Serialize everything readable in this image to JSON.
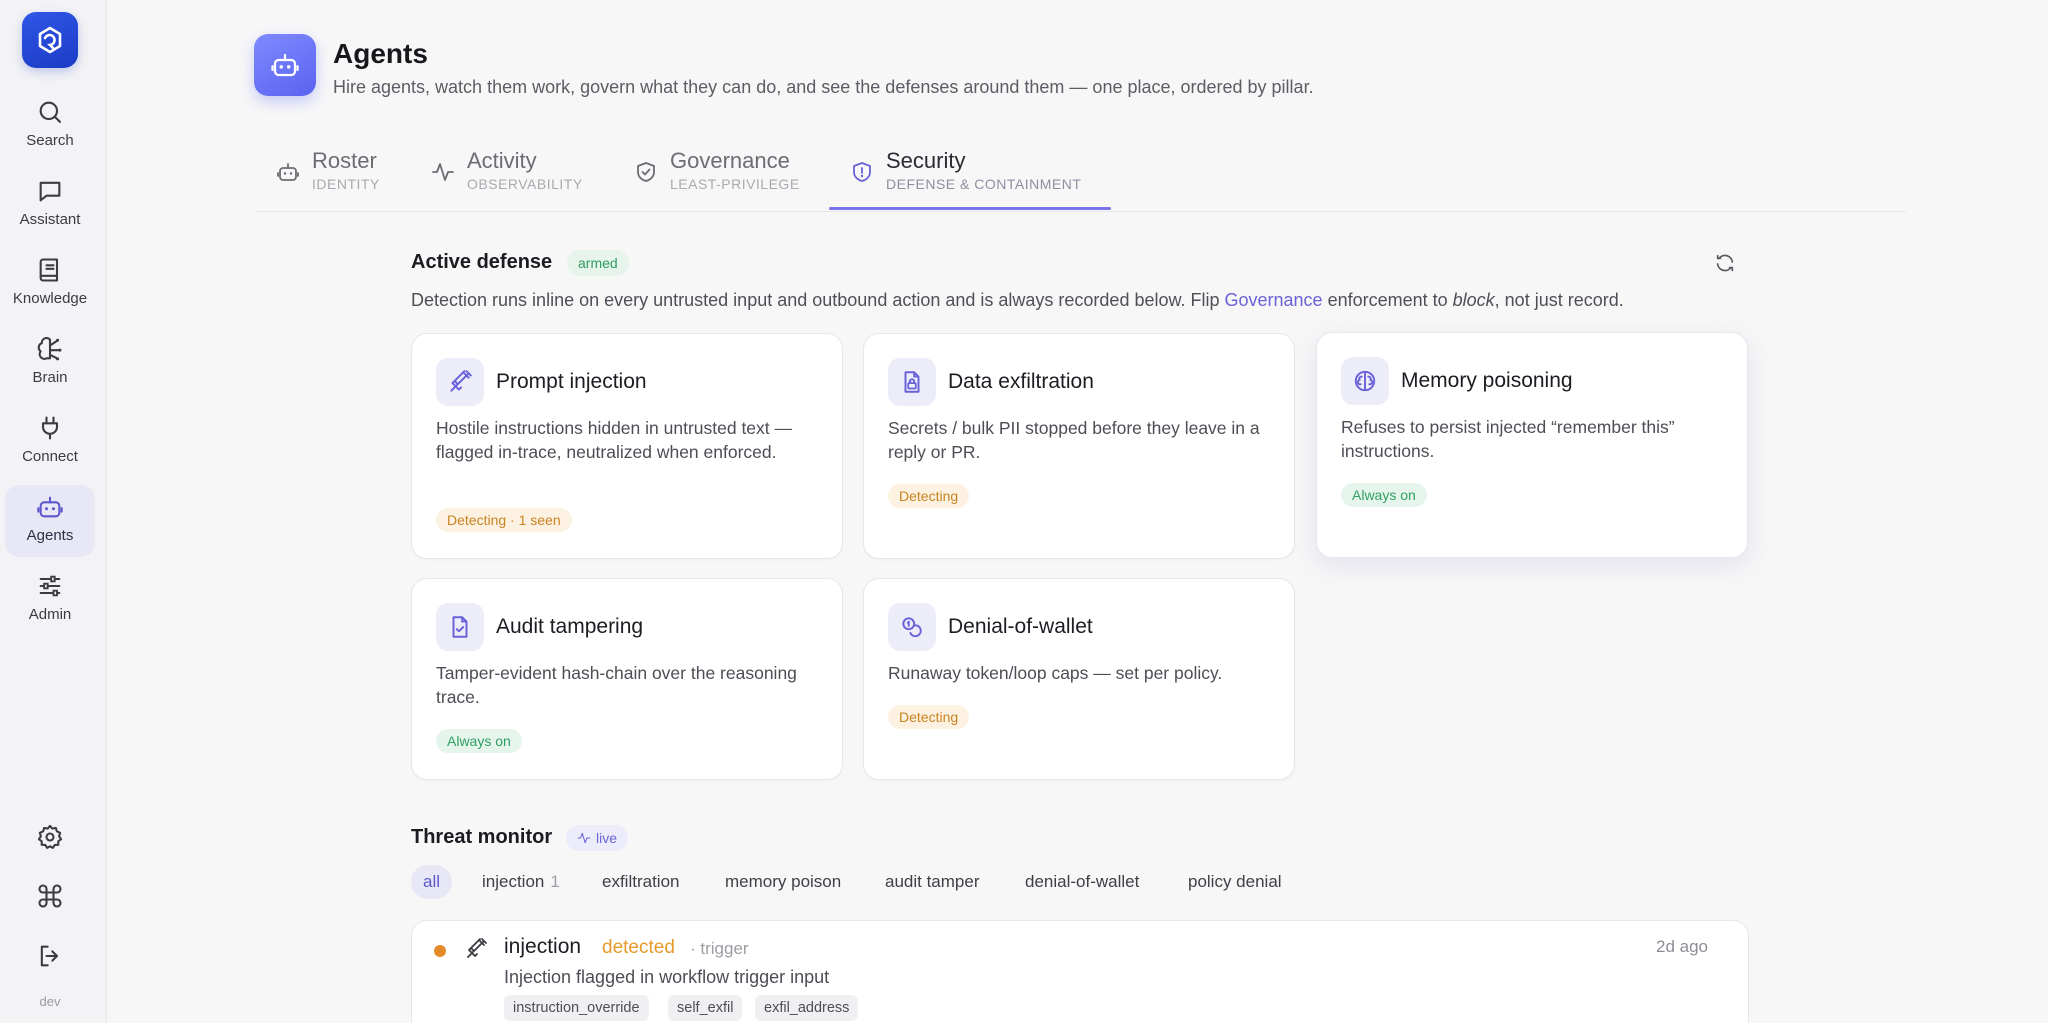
{
  "sidebar": {
    "items": [
      {
        "label": "Search",
        "icon": "search-icon"
      },
      {
        "label": "Assistant",
        "icon": "chat-icon"
      },
      {
        "label": "Knowledge",
        "icon": "book-icon"
      },
      {
        "label": "Brain",
        "icon": "brain-icon"
      },
      {
        "label": "Connect",
        "icon": "plug-icon"
      },
      {
        "label": "Agents",
        "icon": "robot-icon",
        "active": true
      },
      {
        "label": "Admin",
        "icon": "sliders-icon"
      }
    ],
    "bottom": [
      {
        "icon": "gear-icon"
      },
      {
        "icon": "command-icon"
      },
      {
        "icon": "logout-icon"
      }
    ],
    "env_label": "dev"
  },
  "header": {
    "title": "Agents",
    "subtitle": "Hire agents, watch them work, govern what they can do, and see the defenses around them — one place, ordered by pillar."
  },
  "tabs": [
    {
      "title": "Roster",
      "sub": "IDENTITY",
      "icon": "robot-icon"
    },
    {
      "title": "Activity",
      "sub": "OBSERVABILITY",
      "icon": "pulse-icon"
    },
    {
      "title": "Governance",
      "sub": "LEAST-PRIVILEGE",
      "icon": "shield-check-icon"
    },
    {
      "title": "Security",
      "sub": "DEFENSE & CONTAINMENT",
      "icon": "shield-alert-icon",
      "active": true
    }
  ],
  "active_defense": {
    "title": "Active defense",
    "status": "armed",
    "desc_before": "Detection runs inline on every untrusted input and outbound action and is always recorded below. Flip ",
    "desc_link": "Governance",
    "desc_middle": " enforcement to ",
    "desc_em": "block",
    "desc_after": ", not just record.",
    "cards": [
      {
        "title": "Prompt injection",
        "desc": "Hostile instructions hidden in untrusted text — flagged in-trace, neutralized when enforced.",
        "badge": "Detecting · 1 seen",
        "tone": "orange",
        "icon": "syringe-icon"
      },
      {
        "title": "Data exfiltration",
        "desc": "Secrets / bulk PII stopped before they leave in a reply or PR.",
        "badge": "Detecting",
        "tone": "orange",
        "icon": "file-lock-icon"
      },
      {
        "title": "Memory poisoning",
        "desc": "Refuses to persist injected “remember this” instructions.",
        "badge": "Always on",
        "tone": "green",
        "icon": "brain-icon"
      },
      {
        "title": "Audit tampering",
        "desc": "Tamper-evident hash-chain over the reasoning trace.",
        "badge": "Always on",
        "tone": "green",
        "icon": "file-check-icon"
      },
      {
        "title": "Denial-of-wallet",
        "desc": "Runaway token/loop caps — set per policy.",
        "badge": "Detecting",
        "tone": "orange",
        "icon": "coins-icon"
      }
    ]
  },
  "threat_monitor": {
    "title": "Threat monitor",
    "status": "live",
    "filters": [
      {
        "label": "all",
        "active": true
      },
      {
        "label": "injection",
        "count": "1"
      },
      {
        "label": "exfiltration"
      },
      {
        "label": "memory poison"
      },
      {
        "label": "audit tamper"
      },
      {
        "label": "denial-of-wallet"
      },
      {
        "label": "policy denial"
      }
    ],
    "event": {
      "title": "injection",
      "status": "detected",
      "source": "· trigger",
      "time": "2d ago",
      "desc": "Injection flagged in workflow trigger input",
      "tags": [
        "instruction_override",
        "self_exfil",
        "exfil_address"
      ]
    }
  },
  "colors": {
    "accent": "#6a62d8",
    "warning": "#e59a2a",
    "success": "#2f9f63",
    "logo": "#2f56e6"
  }
}
